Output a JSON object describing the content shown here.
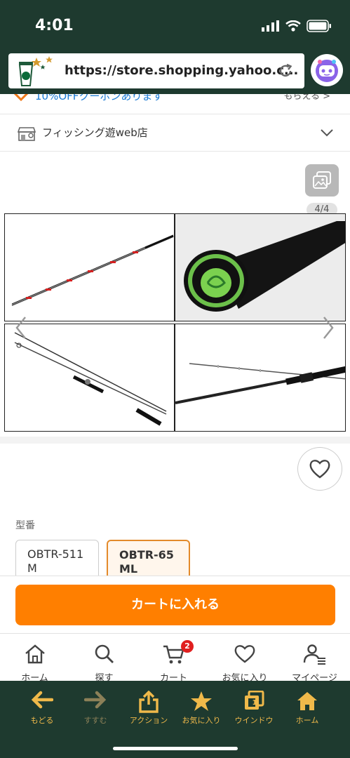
{
  "status": {
    "time": "4:01"
  },
  "browser": {
    "url": "https://store.shopping.yahoo.c...",
    "icons": [
      "reload-icon",
      "app-avatar-icon"
    ]
  },
  "promo": {
    "text": "10%OFFクーポンあります",
    "right": "もらえる >"
  },
  "store": {
    "name": "フィッシング遊web店",
    "icon": "store-icon"
  },
  "gallery": {
    "counter": "4/4"
  },
  "product": {
    "model_label": "型番",
    "options": [
      {
        "label": "OBTR-511 M",
        "selected": false
      },
      {
        "label": "OBTR-65 ML",
        "selected": true
      }
    ],
    "cart_button": "カートに入れる"
  },
  "tabbar": {
    "items": [
      {
        "label": "ホーム",
        "icon": "home-icon"
      },
      {
        "label": "探す",
        "icon": "search-icon"
      },
      {
        "label": "カート",
        "icon": "cart-icon",
        "badge": "2"
      },
      {
        "label": "お気に入り",
        "icon": "heart-icon"
      },
      {
        "label": "マイページ",
        "icon": "user-icon"
      }
    ]
  },
  "toolbar": {
    "items": [
      {
        "label": "もどる",
        "icon": "back-arrow-icon"
      },
      {
        "label": "すすむ",
        "icon": "forward-arrow-icon"
      },
      {
        "label": "アクション",
        "icon": "share-icon"
      },
      {
        "label": "お気に入り",
        "icon": "star-icon"
      },
      {
        "label": "ウインドウ",
        "icon": "windows-icon",
        "count": "1"
      },
      {
        "label": "ホーム",
        "icon": "home-icon"
      }
    ]
  },
  "colors": {
    "accent": "#ff7f00",
    "chrome": "#1e3a2f",
    "toolbar_label": "#f0b94a"
  }
}
